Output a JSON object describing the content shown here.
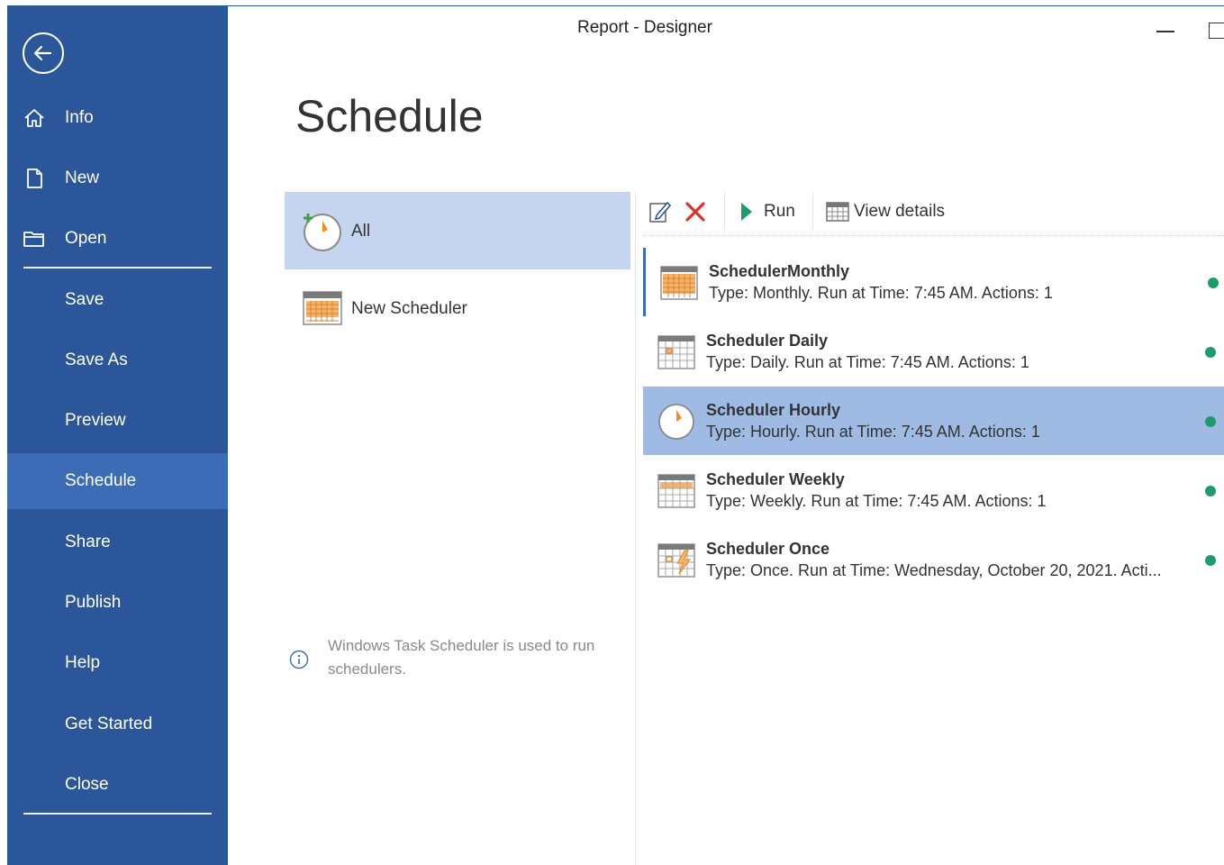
{
  "window": {
    "title": "Report - Designer"
  },
  "sidebar": {
    "items": [
      {
        "label": "Info",
        "icon": "home-icon"
      },
      {
        "label": "New",
        "icon": "new-document-icon"
      },
      {
        "label": "Open",
        "icon": "folder-open-icon"
      },
      {
        "label": "Save"
      },
      {
        "label": "Save As"
      },
      {
        "label": "Preview"
      },
      {
        "label": "Schedule",
        "active": true
      },
      {
        "label": "Share"
      },
      {
        "label": "Publish"
      },
      {
        "label": "Help"
      },
      {
        "label": "Get Started"
      },
      {
        "label": "Close"
      }
    ]
  },
  "page": {
    "title": "Schedule"
  },
  "filters": {
    "all": "All",
    "new_scheduler": "New Scheduler"
  },
  "info_note": "Windows Task Scheduler is used to run schedulers.",
  "toolbar": {
    "run_label": "Run",
    "view_details_label": "View details"
  },
  "schedulers": [
    {
      "name": "SchedulerMonthly",
      "description": "Type: Monthly. Run at Time: 7:45 AM. Actions: 1",
      "icon": "calendar-monthly-icon",
      "status_color": "#1e9b6b"
    },
    {
      "name": "Scheduler Daily",
      "description": "Type: Daily. Run at Time: 7:45 AM. Actions: 1",
      "icon": "calendar-daily-icon",
      "status_color": "#1e9b6b"
    },
    {
      "name": "Scheduler Hourly",
      "description": "Type: Hourly. Run at Time: 7:45 AM. Actions: 1",
      "icon": "clock-icon",
      "status_color": "#1e9b6b"
    },
    {
      "name": "Scheduler Weekly",
      "description": "Type: Weekly. Run at Time: 7:45 AM. Actions: 1",
      "icon": "calendar-weekly-icon",
      "status_color": "#1e9b6b"
    },
    {
      "name": "Scheduler Once",
      "description": "Type: Once. Run at Time: Wednesday, October 20, 2021. Acti...",
      "icon": "calendar-once-icon",
      "status_color": "#1e9b6b"
    }
  ],
  "colors": {
    "sidebar": "#2b579a",
    "sidebar_active": "#3c6cb5",
    "selected_row": "#9fbbe3",
    "filter_selected": "#c5d5ef",
    "status_dot": "#1e9b6b"
  }
}
